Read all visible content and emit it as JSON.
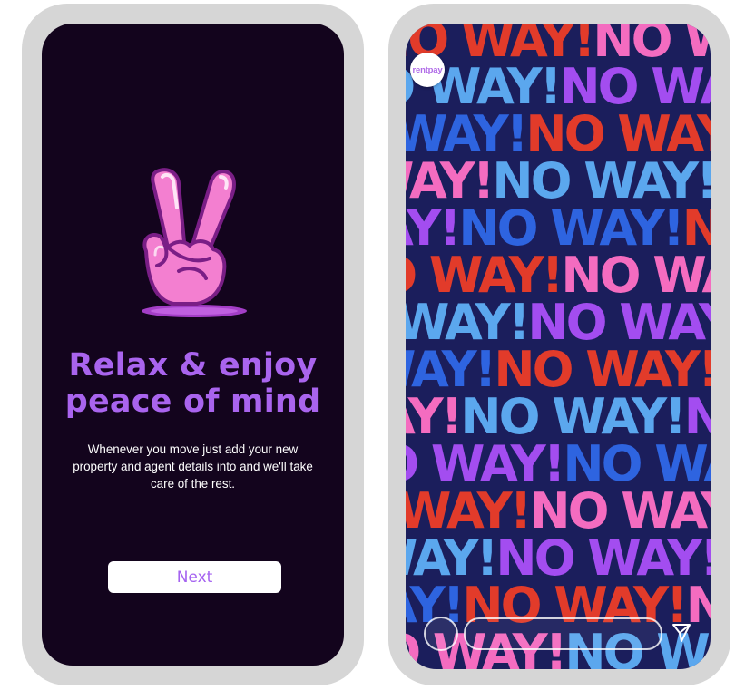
{
  "onboarding": {
    "headline_line1": "Relax & enjoy",
    "headline_line2": "peace of mind",
    "body": "Whenever you move just add your new property and agent details into and we'll take care of the rest.",
    "next_label": "Next",
    "icon": "peace-hand-icon"
  },
  "story": {
    "brand": "rentpay",
    "pattern_text": "NO WAY!",
    "pattern_colors": [
      "#e23b2a",
      "#f46cc0",
      "#5ba7ee",
      "#a34df0",
      "#2e64e0"
    ],
    "icons": [
      "camera-button",
      "send-icon"
    ]
  },
  "colors": {
    "accent": "#a964ee",
    "left_background": "#13041d",
    "frame": "#d6d6d6"
  }
}
